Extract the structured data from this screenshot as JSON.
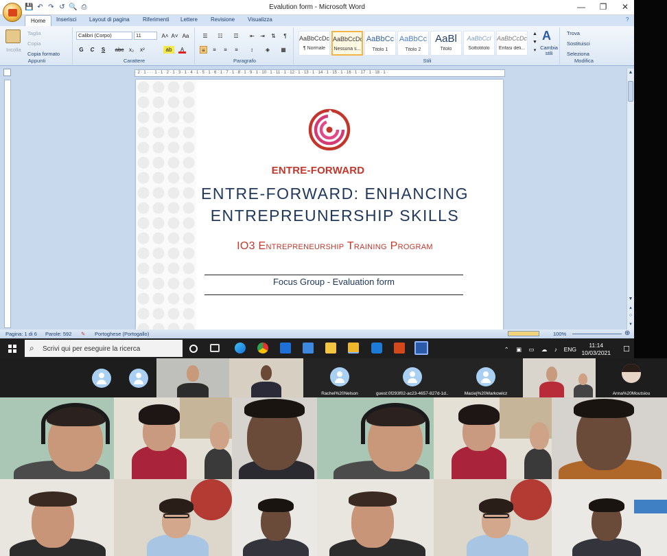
{
  "window": {
    "title": "Evalution form - Microsoft Word",
    "controls": {
      "minimize": "—",
      "maximize": "❐",
      "close": "✕"
    }
  },
  "qat": [
    "💾",
    "↶",
    "↷",
    "↺",
    "🔍",
    "⎙"
  ],
  "tabs": [
    "Home",
    "Inserisci",
    "Layout di pagina",
    "Riferimenti",
    "Lettere",
    "Revisione",
    "Visualizza"
  ],
  "ribbon": {
    "clipboard": {
      "label": "Appunti",
      "paste": "Incolla",
      "cut": "Taglia",
      "copy": "Copia",
      "format_painter": "Copia formato"
    },
    "font": {
      "label": "Carattere",
      "family": "Calibri (Corpo)",
      "size": "11",
      "bold": "G",
      "italic": "C",
      "underline": "S",
      "strike": "abc",
      "sub": "x₂",
      "sup": "x²",
      "grow": "A˄",
      "shrink": "A˅",
      "clear": "Aa",
      "highlight": "ab",
      "color": "A"
    },
    "paragraph": {
      "label": "Paragrafo"
    },
    "styles": {
      "label": "Stili",
      "items": [
        {
          "sample": "AaBbCcDc",
          "name": "¶ Normale"
        },
        {
          "sample": "AaBbCcDc",
          "name": "Nessuna s..."
        },
        {
          "sample": "AaBbCc",
          "name": "Titolo 1"
        },
        {
          "sample": "AaBbCc",
          "name": "Titolo 2"
        },
        {
          "sample": "AaBl",
          "name": "Titolo"
        },
        {
          "sample": "AaBbCcl",
          "name": "Sottotitolo"
        },
        {
          "sample": "AaBbCcDc",
          "name": "Enfasi deli..."
        }
      ],
      "change": "Cambia stili"
    },
    "editing": {
      "label": "Modifica",
      "find": "Trova",
      "replace": "Sostituisci",
      "select": "Seleziona"
    }
  },
  "ruler_text": "· 2 · 1 · · · 1 · 1 · 2 · 1 · 3 · 1 · 4 · 1 · 5 · 1 · 6 · 1 · 7 · 1 · 8 · 1 · 9 · 1 · 10 · 1 · 11 · 1 · 12 · 1 · 13 · 1 · 14 · 1 · 15 · 1 · 16 · 1 · 17 · 1 · 18 · 1 ·",
  "document": {
    "brand": "ENTRE-FORWARD",
    "title_line1": "ENTRE-FORWARD: ENHANCING",
    "title_line2": "ENTREPREUNERSHIP SKILLS",
    "subtitle": "IO3 Entrepreneurship Training Program",
    "form_title": "Focus Group - Evaluation form"
  },
  "status": {
    "page": "Pagina: 1 di 6",
    "words": "Parole: 592",
    "language": "Portoghese (Portogallo)",
    "zoom": "100%"
  },
  "taskbar": {
    "search_placeholder": "Scrivi qui per eseguire la ricerca",
    "language": "ENG",
    "time": "11:14",
    "date": "10/03/2021",
    "tray_icons": "⌃ ▣ ▭ ☁ ♪",
    "notification": "☐"
  },
  "participants": [
    {
      "name": ""
    },
    {
      "name": ""
    },
    {
      "name": ""
    },
    {
      "name": ""
    },
    {
      "name": "Rachel%20Nelson"
    },
    {
      "name": "guest:0f293f02-ac23-4657-827d-1d..."
    },
    {
      "name": "Maciej%20Markowicz"
    },
    {
      "name": ""
    },
    {
      "name": "Anna%20Moutsiou"
    }
  ],
  "colors": {
    "brand_red": "#c3362b",
    "title_navy": "#20385c",
    "ribbon_blue": "#dbe7f5"
  }
}
